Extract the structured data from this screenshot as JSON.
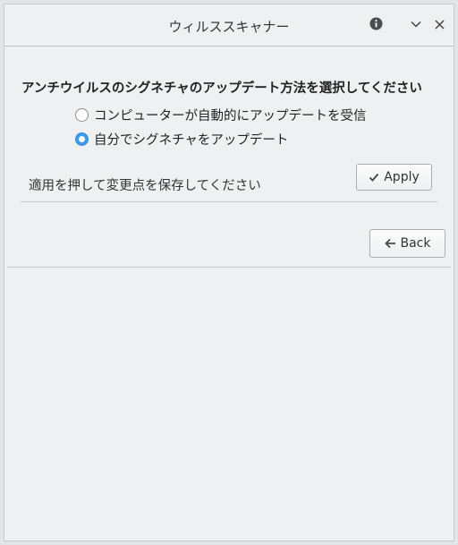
{
  "window": {
    "title": "ウィルススキャナー"
  },
  "titlebar": {
    "info_icon": "info-icon",
    "minimize_icon": "chevron-down-icon",
    "close_icon": "close-icon"
  },
  "update_section": {
    "heading": "アンチウイルスのシグネチャのアップデート方法を選択してください",
    "options": [
      {
        "label": "コンピューターが自動的にアップデートを受信",
        "selected": false
      },
      {
        "label": "自分でシグネチャをアップデート",
        "selected": true
      }
    ],
    "apply_hint": "適用を押して変更点を保存してください",
    "apply_label": "Apply",
    "apply_icon": "checkmark-icon"
  },
  "navigation": {
    "back_label": "Back",
    "back_icon": "arrow-left-icon"
  },
  "colors": {
    "accent": "#3d9ae8",
    "window_bg": "#eff0f1"
  }
}
